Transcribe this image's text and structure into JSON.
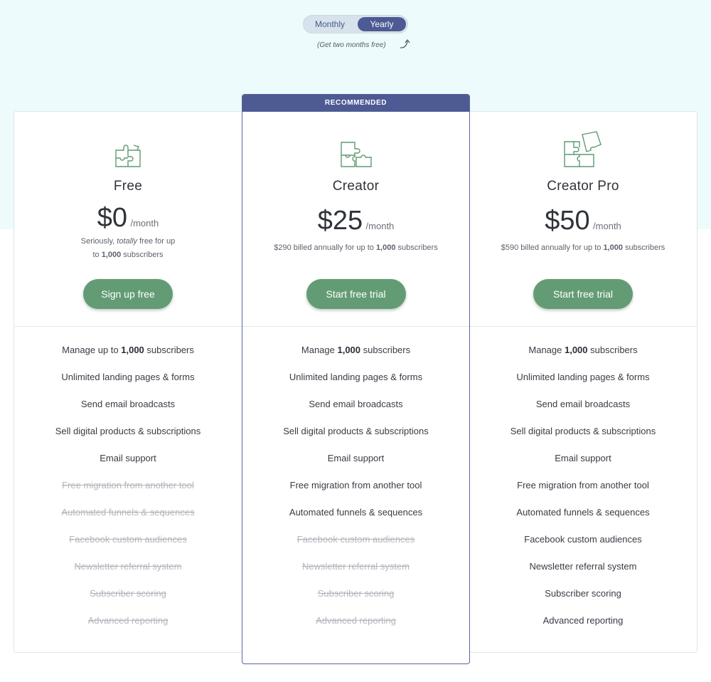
{
  "billing_toggle": {
    "monthly_label": "Monthly",
    "yearly_label": "Yearly",
    "selected": "Yearly",
    "note": "(Get two months free)"
  },
  "colors": {
    "accent": "#4d5a93",
    "cta": "#639c74",
    "background_top": "#eefbfc"
  },
  "plans": [
    {
      "name": "Free",
      "icon": "puzzle-icon",
      "price": "$0",
      "period": "/month",
      "note_pre": "Seriously, ",
      "note_em": "totally",
      "note_mid": " free for up",
      "note_line2_pre": "to ",
      "note_bold": "1,000",
      "note_post": " subscribers",
      "cta": "Sign up free",
      "features": [
        {
          "pre": "Manage up to ",
          "bold": "1,000",
          "post": " subscribers",
          "included": true
        },
        {
          "pre": "Unlimited landing pages & forms",
          "included": true
        },
        {
          "pre": "Send email broadcasts",
          "included": true
        },
        {
          "pre": "Sell digital products & subscriptions",
          "included": true
        },
        {
          "pre": "Email support",
          "included": true
        },
        {
          "pre": "Free migration from another tool",
          "included": false
        },
        {
          "pre": "Automated funnels & sequences",
          "included": false
        },
        {
          "pre": "Facebook custom audiences",
          "included": false
        },
        {
          "pre": "Newsletter referral system",
          "included": false
        },
        {
          "pre": "Subscriber scoring",
          "included": false
        },
        {
          "pre": "Advanced reporting",
          "included": false
        }
      ]
    },
    {
      "name": "Creator",
      "icon": "puzzle-icon",
      "recommended_label": "RECOMMENDED",
      "price": "$25",
      "period": "/month",
      "note_pre": "$290 billed annually for up to ",
      "note_bold": "1,000",
      "note_post": " subscribers",
      "cta": "Start free trial",
      "features": [
        {
          "pre": "Manage ",
          "bold": "1,000",
          "post": " subscribers",
          "included": true
        },
        {
          "pre": "Unlimited landing pages & forms",
          "included": true
        },
        {
          "pre": "Send email broadcasts",
          "included": true
        },
        {
          "pre": "Sell digital products & subscriptions",
          "included": true
        },
        {
          "pre": "Email support",
          "included": true
        },
        {
          "pre": "Free migration from another tool",
          "included": true
        },
        {
          "pre": "Automated funnels & sequences",
          "included": true
        },
        {
          "pre": "Facebook custom audiences",
          "included": false
        },
        {
          "pre": "Newsletter referral system",
          "included": false
        },
        {
          "pre": "Subscriber scoring",
          "included": false
        },
        {
          "pre": "Advanced reporting",
          "included": false
        }
      ]
    },
    {
      "name": "Creator Pro",
      "icon": "puzzle-icon",
      "price": "$50",
      "period": "/month",
      "note_pre": "$590 billed annually for up to ",
      "note_bold": "1,000",
      "note_post": " subscribers",
      "cta": "Start free trial",
      "features": [
        {
          "pre": "Manage ",
          "bold": "1,000",
          "post": " subscribers",
          "included": true
        },
        {
          "pre": "Unlimited landing pages & forms",
          "included": true
        },
        {
          "pre": "Send email broadcasts",
          "included": true
        },
        {
          "pre": "Sell digital products & subscriptions",
          "included": true
        },
        {
          "pre": "Email support",
          "included": true
        },
        {
          "pre": "Free migration from another tool",
          "included": true
        },
        {
          "pre": "Automated funnels & sequences",
          "included": true
        },
        {
          "pre": "Facebook custom audiences",
          "included": true
        },
        {
          "pre": "Newsletter referral system",
          "included": true
        },
        {
          "pre": "Subscriber scoring",
          "included": true
        },
        {
          "pre": "Advanced reporting",
          "included": true
        }
      ]
    }
  ]
}
